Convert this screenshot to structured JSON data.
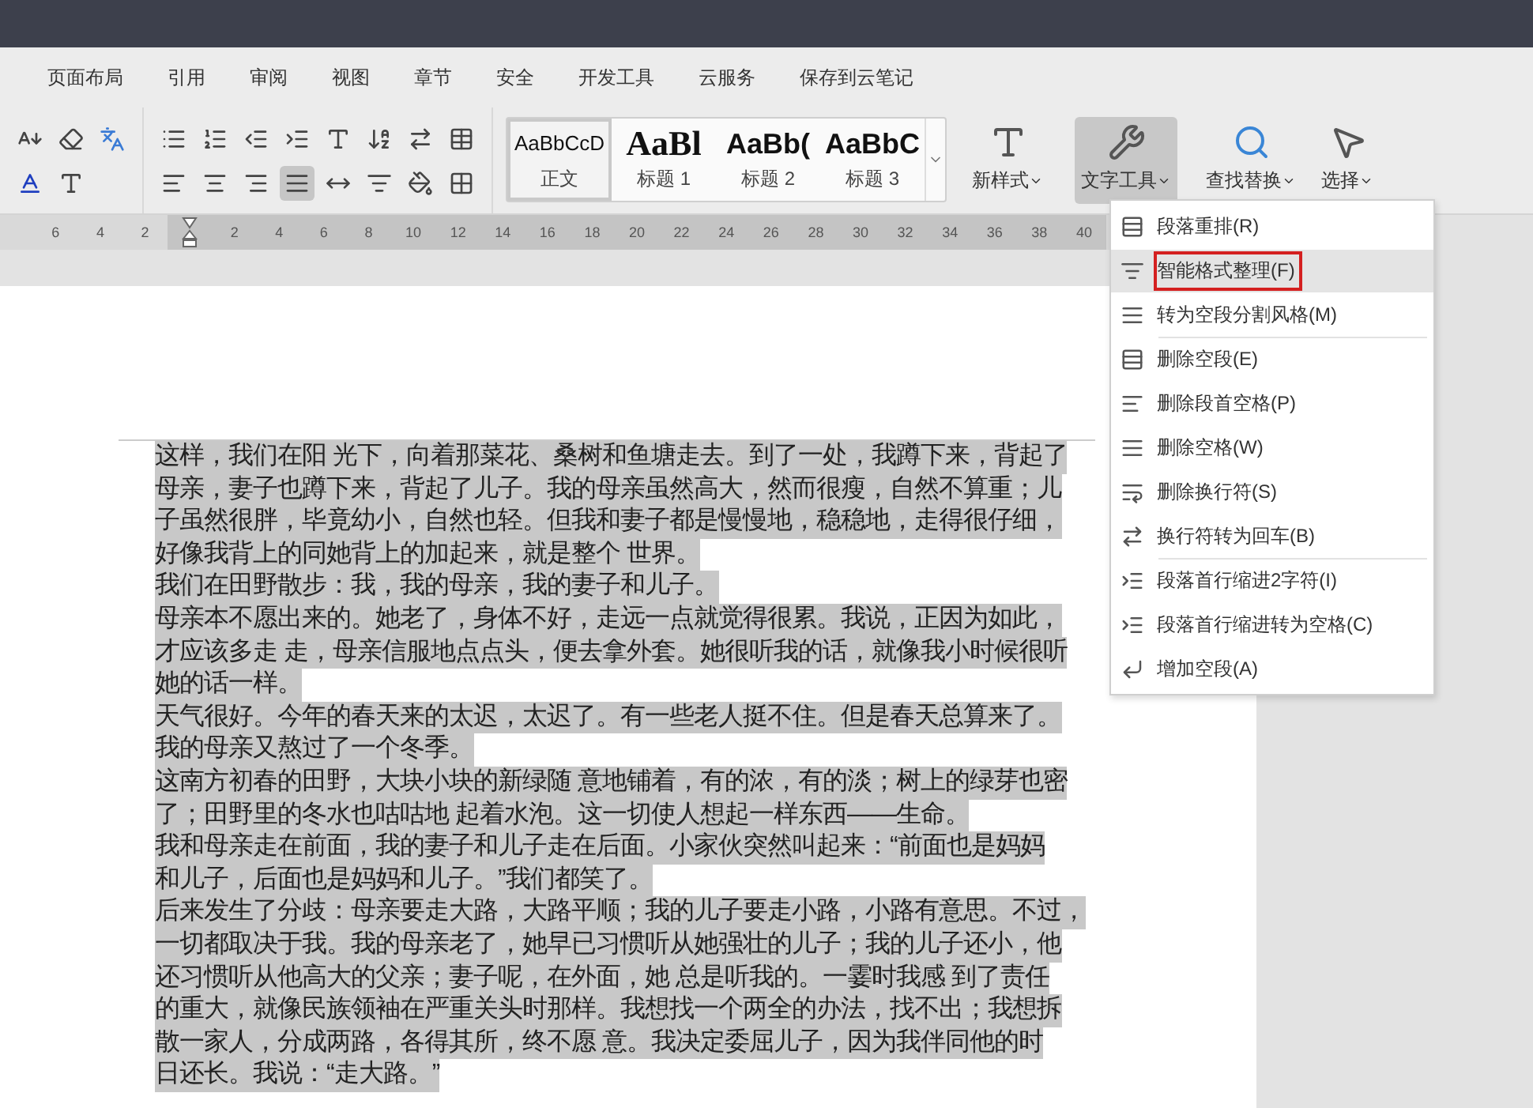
{
  "menu_tabs": [
    {
      "label": "页面布局"
    },
    {
      "label": "引用"
    },
    {
      "label": "审阅"
    },
    {
      "label": "视图"
    },
    {
      "label": "章节"
    },
    {
      "label": "安全"
    },
    {
      "label": "开发工具"
    },
    {
      "label": "云服务"
    },
    {
      "label": "保存到云笔记"
    }
  ],
  "alignment": [
    {
      "kind": "left",
      "selected": false
    },
    {
      "kind": "center",
      "selected": false
    },
    {
      "kind": "right",
      "selected": false
    },
    {
      "kind": "justify",
      "selected": true
    },
    {
      "kind": "distributed",
      "selected": false
    }
  ],
  "styles": [
    {
      "sample": "AaBbCcD",
      "label": "正文",
      "kind": "body",
      "selected": true
    },
    {
      "sample": "AaBl",
      "label": "标题 1",
      "kind": "h1",
      "selected": false
    },
    {
      "sample": "AaBb(",
      "label": "标题 2",
      "kind": "h2",
      "selected": false
    },
    {
      "sample": "AaBbC",
      "label": "标题 3",
      "kind": "h3",
      "selected": false
    }
  ],
  "new_style": {
    "label": "新样式"
  },
  "text_tools": {
    "label": "文字工具",
    "expanded": true
  },
  "find_replace": {
    "label": "查找替换"
  },
  "select": {
    "label": "选择"
  },
  "ruler": {
    "left_ticks": [
      "6",
      "4",
      "2"
    ],
    "right_ticks": [
      "2",
      "4",
      "6",
      "8",
      "10",
      "12",
      "14",
      "16",
      "18",
      "20",
      "22",
      "24",
      "26",
      "28",
      "30",
      "32",
      "34",
      "36",
      "38",
      "40"
    ]
  },
  "text_tools_menu": [
    {
      "label": "段落重排(R)",
      "kind": "reflow",
      "selected": false,
      "separator_before": false
    },
    {
      "label": "智能格式整理(F)",
      "kind": "smart",
      "selected": true,
      "separator_before": false
    },
    {
      "label": "转为空段分割风格(M)",
      "kind": "lines",
      "selected": false,
      "separator_before": false
    },
    {
      "label": "删除空段(E)",
      "kind": "del-empty",
      "selected": false,
      "separator_before": true
    },
    {
      "label": "删除段首空格(P)",
      "kind": "del-lead",
      "selected": false,
      "separator_before": false
    },
    {
      "label": "删除空格(W)",
      "kind": "del-space",
      "selected": false,
      "separator_before": false
    },
    {
      "label": "删除换行符(S)",
      "kind": "del-break",
      "selected": false,
      "separator_before": false
    },
    {
      "label": "换行符转为回车(B)",
      "kind": "convert",
      "selected": false,
      "separator_before": false
    },
    {
      "label": "段落首行缩进2字符(I)",
      "kind": "indent",
      "selected": false,
      "separator_before": true
    },
    {
      "label": "段落首行缩进转为空格(C)",
      "kind": "indent",
      "selected": false,
      "separator_before": false
    },
    {
      "label": "增加空段(A)",
      "kind": "add",
      "selected": false,
      "separator_before": false
    }
  ],
  "document": {
    "paragraphs": [
      {
        "lines": [
          "这样，我们在阳 光下，向着那菜花、桑树和鱼塘走去。到了一处，我蹲下来，背起了",
          "母亲，妻子也蹲下来，背起了儿子。我的母亲虽然高大，然而很瘦，自然不算重；儿",
          "子虽然很胖，毕竟幼小，自然也轻。但我和妻子都是慢慢地，稳稳地，走得很仔细，",
          "好像我背上的同她背上的加起来，就是整个 世界。"
        ]
      },
      {
        "lines": [
          "我们在田野散步：我，我的母亲，我的妻子和儿子。"
        ]
      },
      {
        "lines": [
          "母亲本不愿出来的。她老了，身体不好，走远一点就觉得很累。我说，正因为如此，",
          "才应该多走 走，母亲信服地点点头，便去拿外套。她很听我的话，就像我小时候很听",
          "她的话一样。"
        ]
      },
      {
        "lines": [
          "天气很好。今年的春天来的太迟，太迟了。有一些老人挺不住。但是春天总算来了。",
          "我的母亲又熬过了一个冬季。"
        ]
      },
      {
        "lines": [
          "这南方初春的田野，大块小块的新绿随 意地铺着，有的浓，有的淡；树上的绿芽也密",
          "了；田野里的冬水也咕咕地 起着水泡。这一切使人想起一样东西——生命。"
        ]
      },
      {
        "lines": [
          "我和母亲走在前面，我的妻子和儿子走在后面。小家伙突然叫起来：“前面也是妈妈",
          "和儿子，后面也是妈妈和儿子。”我们都笑了。"
        ]
      },
      {
        "lines": [
          "后来发生了分歧：母亲要走大路，大路平顺；我的儿子要走小路，小路有意思。不过，",
          "一切都取决于我。我的母亲老了，她早已习惯听从她强壮的儿子；我的儿子还小，他",
          "还习惯听从他高大的父亲；妻子呢，在外面，她 总是听我的。一霎时我感  到了责任",
          "的重大，就像民族领袖在严重关头时那样。我想找一个两全的办法，找不出；我想拆",
          "散一家人，分成两路，各得其所，终不愿  意。我决定委屈儿子，因为我伴同他的时",
          "日还长。我说：“走大路。”"
        ]
      }
    ]
  }
}
